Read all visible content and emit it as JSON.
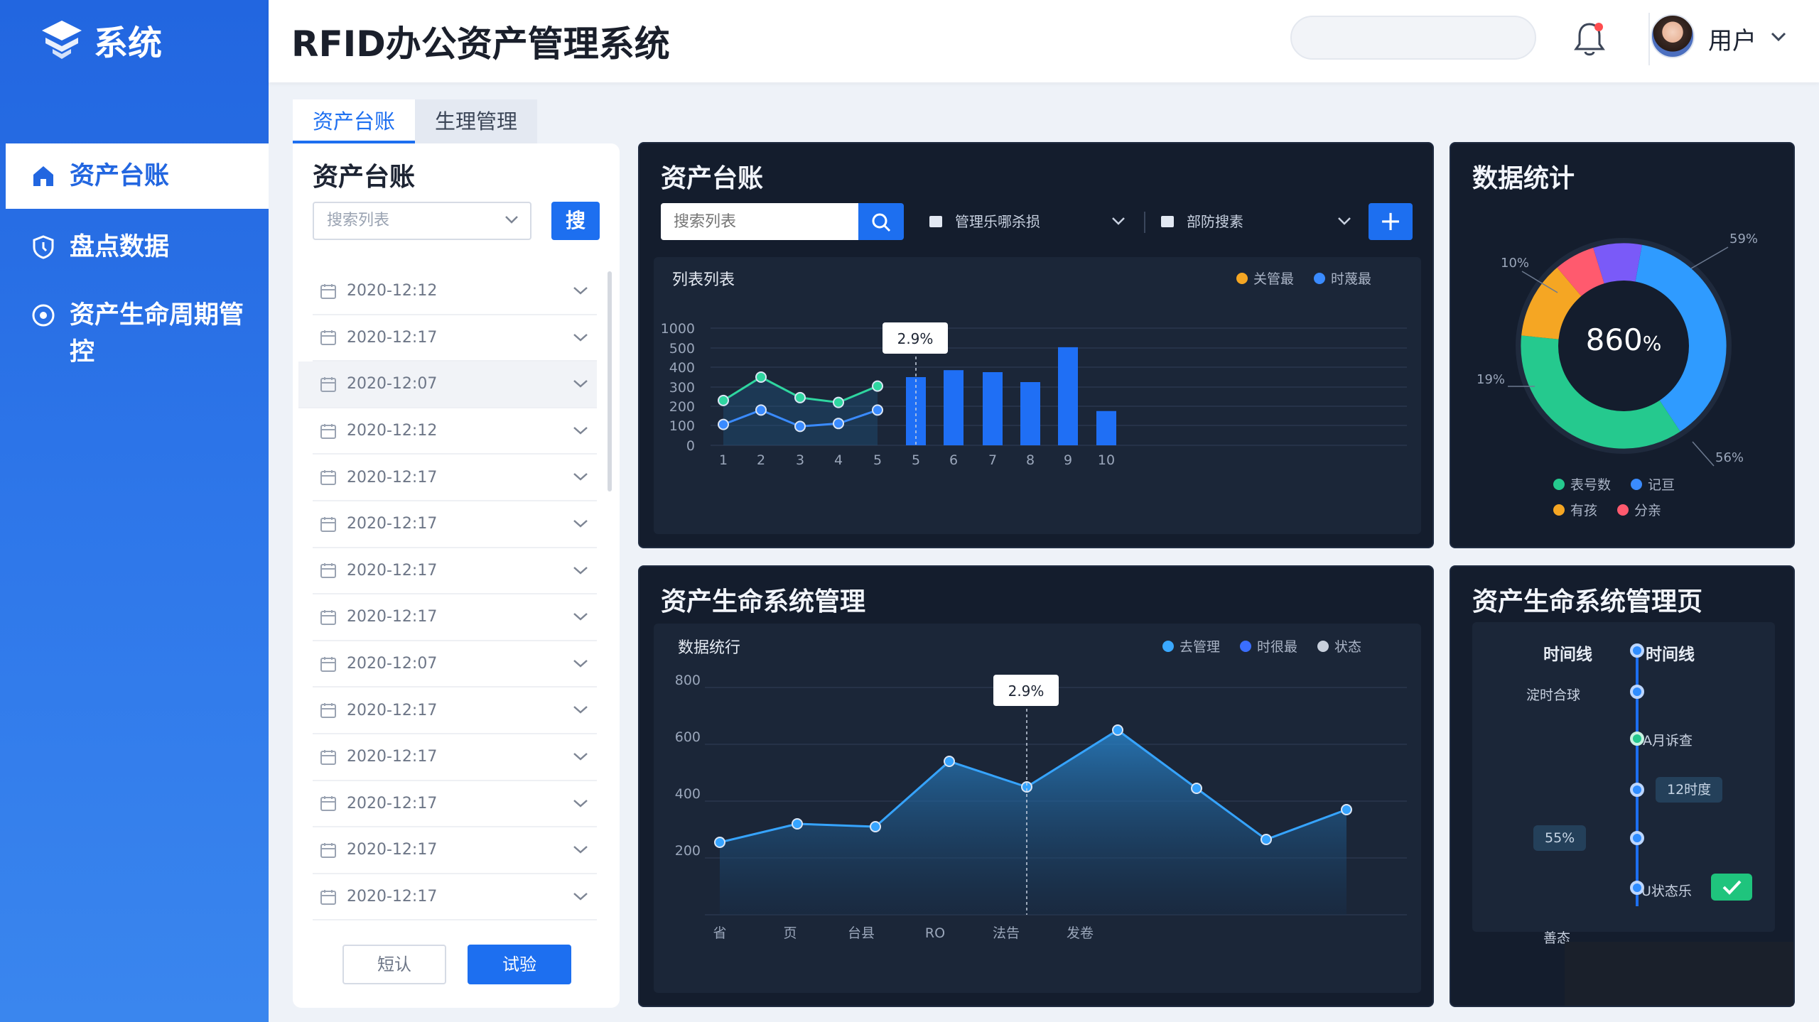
{
  "app": {
    "logo_text": "系统",
    "page_title": "RFID办公资产管理系统",
    "user_name": "用户"
  },
  "sidebar": {
    "items": [
      {
        "label": "资产台账",
        "icon": "home-icon",
        "active": true
      },
      {
        "label": "盘点数据",
        "icon": "shield-icon",
        "active": false
      },
      {
        "label": "资产生命周期管控",
        "icon": "target-icon",
        "active": false
      }
    ]
  },
  "tabs": [
    {
      "label": "资产台账",
      "active": true
    },
    {
      "label": "生理管理",
      "active": false
    }
  ],
  "list_panel": {
    "title": "资产台账",
    "select_placeholder": "搜索列表",
    "search_button": "搜",
    "rows": [
      "2020-12:12",
      "2020-12:17",
      "2020-12:07",
      "2020-12:12",
      "2020-12:17",
      "2020-12:17",
      "2020-12:17",
      "2020-12:17",
      "2020-12:07",
      "2020-12:17",
      "2020-12:17",
      "2020-12:17",
      "2020-12:17",
      "2020-12:17"
    ],
    "selected_row": 2,
    "cancel_button": "短认",
    "confirm_button": "试验"
  },
  "asset_ledger_card": {
    "title": "资产台账",
    "search_placeholder": "搜索列表",
    "dropdown1": "管理乐哪杀损",
    "dropdown2": "部防搜素",
    "add_button": "+",
    "chart_title": "列表列表",
    "legend": [
      {
        "label": "关管最",
        "color": "#f5a623"
      },
      {
        "label": "时蔑最",
        "color": "#3a8bff"
      }
    ]
  },
  "stats_card": {
    "title": "数据统计",
    "center_value": "860",
    "center_unit": "%",
    "legend": [
      {
        "label": "表号数",
        "color": "#25c98e"
      },
      {
        "label": "记亘",
        "color": "#3a8bff"
      },
      {
        "label": "有孩",
        "color": "#f5a623"
      },
      {
        "label": "分亲",
        "color": "#ff5a6e"
      }
    ]
  },
  "lifecycle_card": {
    "title": "资产生命系统管理",
    "chart_title": "数据统行",
    "legend": [
      {
        "label": "去管理",
        "color": "#3aa8ff"
      },
      {
        "label": "时很最",
        "color": "#3a6eff"
      },
      {
        "label": "状态",
        "color": "#c8d0dc"
      }
    ]
  },
  "timeline_card": {
    "title": "资产生命系统管理页",
    "head_left": "时间线",
    "head_right": "时间线",
    "items": [
      {
        "label": "淀时合球",
        "side": "left"
      },
      {
        "label": "A月诉查",
        "side": "right"
      },
      {
        "label": "12时度",
        "side": "right-tag"
      },
      {
        "label": "55%",
        "side": "left-tag"
      },
      {
        "label": "U状态乐",
        "side": "right"
      }
    ],
    "footer_label": "善态"
  },
  "chart_data": [
    {
      "type": "bar",
      "title": "列表列表",
      "ylim": [
        0,
        1000
      ],
      "y_ticks": [
        "0",
        "100",
        "200",
        "300",
        "400",
        "500",
        "1000"
      ],
      "line_x": [
        "1",
        "2",
        "3",
        "4",
        "5"
      ],
      "line_series": [
        {
          "name": "关管最",
          "color": "#2fd6a0",
          "values": [
            230,
            350,
            245,
            220,
            305
          ]
        },
        {
          "name": "时蔑最",
          "color": "#3a8bff",
          "values": [
            105,
            180,
            95,
            110,
            180
          ]
        }
      ],
      "bar_categories": [
        "5",
        "6",
        "7",
        "8",
        "9",
        "10"
      ],
      "bar_values": [
        350,
        385,
        375,
        325,
        520,
        175
      ],
      "annotation": "2.9%"
    },
    {
      "type": "pie",
      "title": "数据统计",
      "slices": [
        {
          "label": "记亘",
          "value": 59,
          "color": "#2f9bff"
        },
        {
          "label": "表号数",
          "value": 56,
          "color": "#25c98e"
        },
        {
          "label": "有孩",
          "value": 19,
          "color": "#f5a623"
        },
        {
          "label": "分亲",
          "value": 10,
          "color": "#ff5a6e"
        },
        {
          "label": "",
          "value": 12,
          "color": "#7a5af8"
        }
      ],
      "labels": [
        "59%",
        "56%",
        "19%",
        "10%"
      ]
    },
    {
      "type": "area",
      "title": "数据统行",
      "ylim": [
        100,
        800
      ],
      "y_ticks": [
        "800",
        "600",
        "400",
        "200"
      ],
      "x_labels": [
        "省",
        "页",
        "台县",
        "RO",
        "法告",
        "发卷"
      ],
      "values": [
        255,
        320,
        310,
        540,
        450,
        650,
        445,
        265,
        370
      ],
      "annotation": "2.9%"
    }
  ]
}
